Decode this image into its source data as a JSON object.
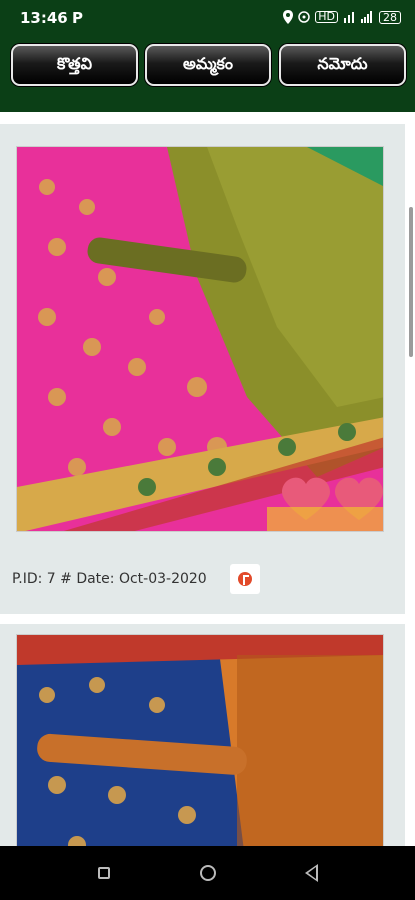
{
  "status": {
    "time": "13:46",
    "app_indicator": "P",
    "icons": [
      "location-icon",
      "hotspot-icon",
      "hd-icon",
      "signal-icon",
      "wifi-icon",
      "battery-icon"
    ],
    "hd_label": "HD",
    "battery_level": "28"
  },
  "tabs": [
    {
      "label": "కొత్తవి"
    },
    {
      "label": "అమ్మకం"
    },
    {
      "label": "నమోదు"
    }
  ],
  "products": [
    {
      "caption": "P.ID: 7 # Date: Oct-03-2020",
      "colors": {
        "primary": "#e8309a",
        "secondary": "#8b8f2a",
        "gold": "#d7a94a"
      }
    },
    {
      "colors": {
        "primary": "#1e3f8a",
        "secondary": "#d87a2a",
        "gold": "#d9a24a"
      }
    }
  ],
  "theme": {
    "header_bg": "#0b3f16",
    "card_bg": "#e3e9e9",
    "flag_color": "#e24a2a"
  }
}
